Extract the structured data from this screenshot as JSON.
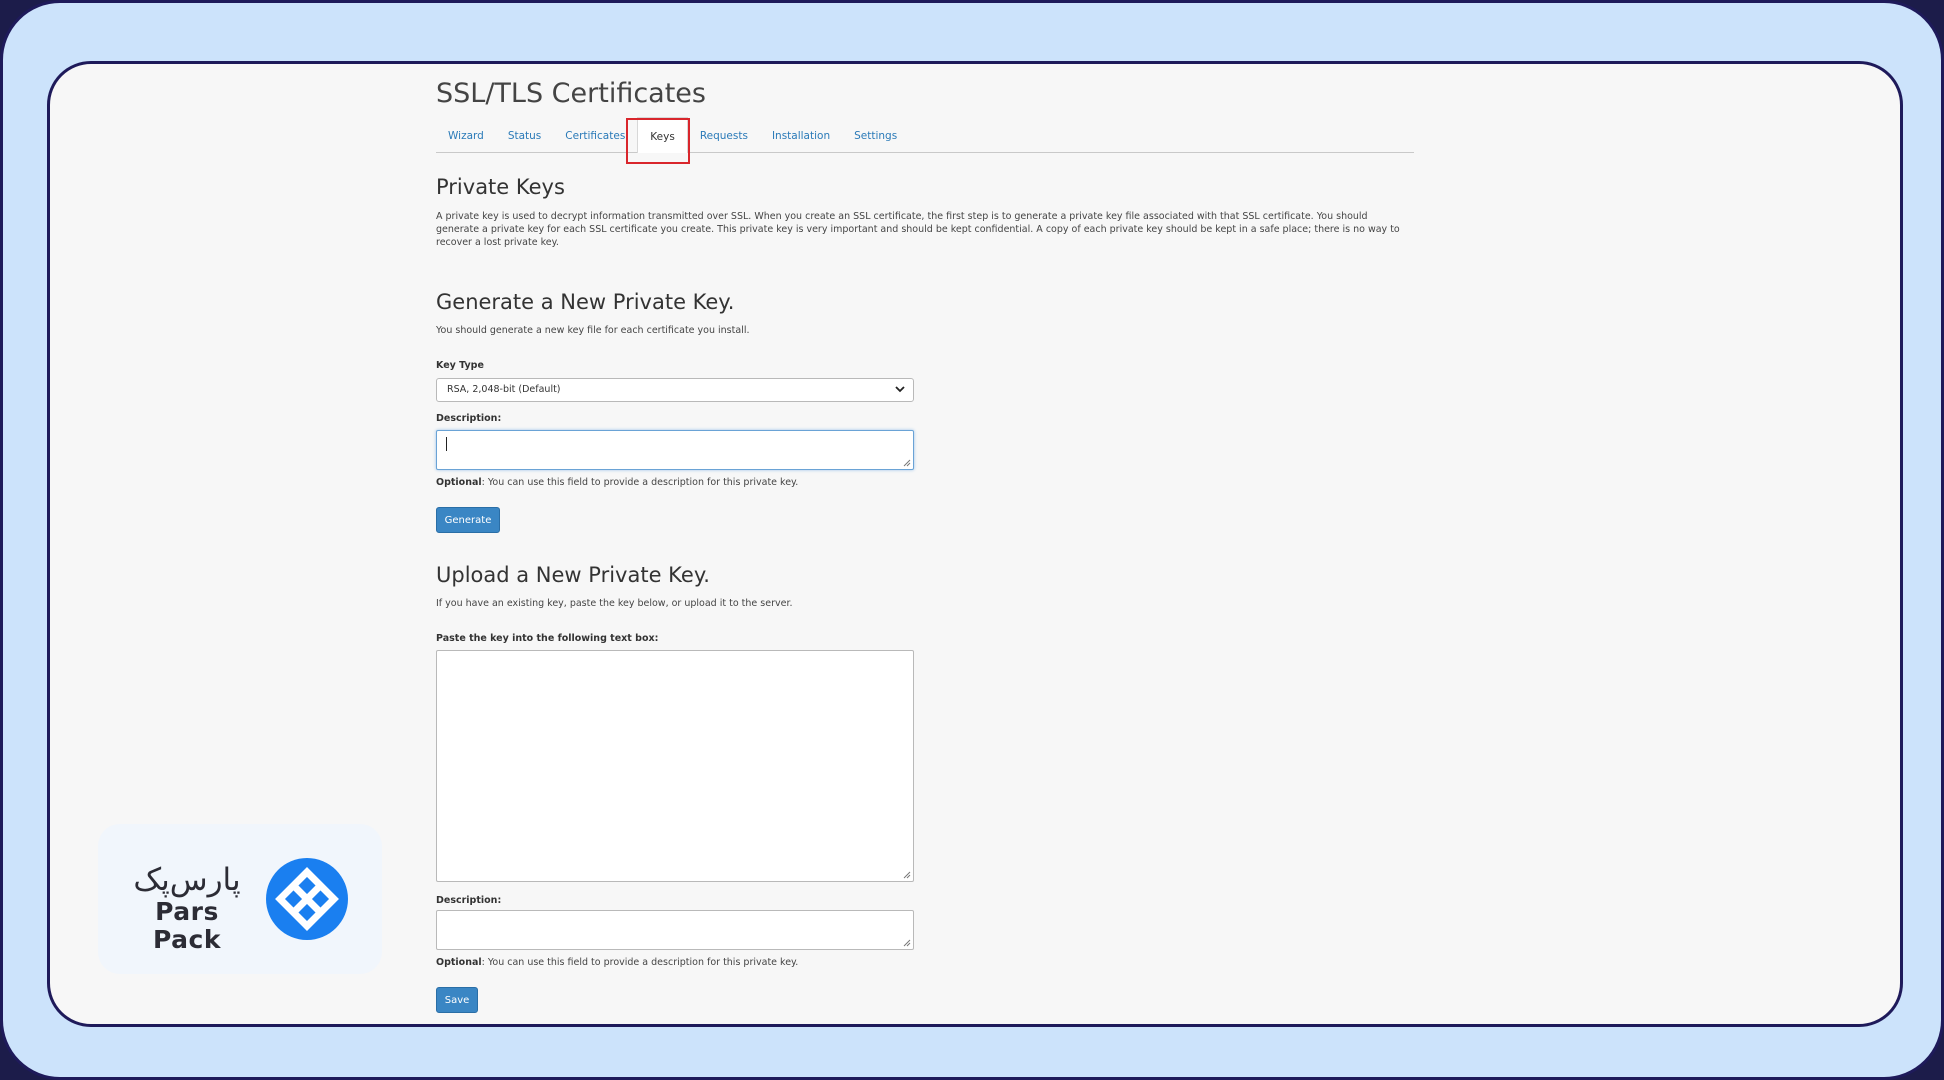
{
  "page": {
    "title": "SSL/TLS Certificates"
  },
  "tabs": [
    {
      "label": "Wizard",
      "active": false
    },
    {
      "label": "Status",
      "active": false
    },
    {
      "label": "Certificates",
      "active": false
    },
    {
      "label": "Keys",
      "active": true
    },
    {
      "label": "Requests",
      "active": false
    },
    {
      "label": "Installation",
      "active": false
    },
    {
      "label": "Settings",
      "active": false
    }
  ],
  "private_keys": {
    "heading": "Private Keys",
    "description": "A private key is used to decrypt information transmitted over SSL. When you create an SSL certificate, the first step is to generate a private key file associated with that SSL certificate. You should generate a private key for each SSL certificate you create. This private key is very important and should be kept confidential. A copy of each private key should be kept in a safe place; there is no way to recover a lost private key."
  },
  "generate": {
    "heading": "Generate a New Private Key.",
    "subtext": "You should generate a new key file for each certificate you install.",
    "key_type_label": "Key Type",
    "key_type_value": "RSA, 2,048-bit  (Default)",
    "description_label": "Description:",
    "description_value": "",
    "hint_bold": "Optional",
    "hint_text": ": You can use this field to provide a description for this private key.",
    "button_label": "Generate"
  },
  "upload": {
    "heading": "Upload a New Private Key.",
    "subtext": "If you have an existing key, paste the key below, or upload it to the server.",
    "paste_label": "Paste the key into the following text box:",
    "paste_value": "",
    "description_label": "Description:",
    "description_value": "",
    "hint_bold": "Optional",
    "hint_text": ": You can use this field to provide a description for this private key.",
    "button_label": "Save"
  },
  "logo": {
    "text_fa": "پارس‌پک",
    "text_en": "Pars Pack",
    "brand_color": "#1a7ff0"
  }
}
